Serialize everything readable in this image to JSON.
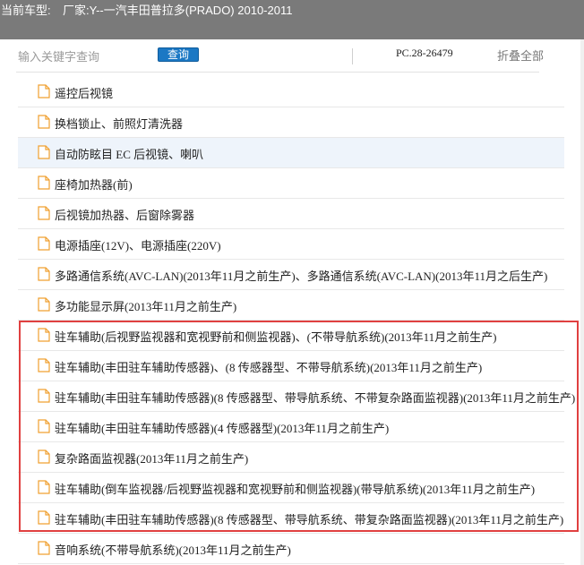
{
  "header": {
    "car_model_label": "当前车型:",
    "car_model_value": "厂家:Y--一汽丰田普拉多(PRADO) 2010-2011"
  },
  "search": {
    "placeholder": "输入关键字查询",
    "button_label": "查询"
  },
  "toolbar": {
    "pc_code": "PC.28-26479",
    "collapse_all_label": "折叠全部"
  },
  "colors": {
    "header_bg": "#7a7a7a",
    "button_bg": "#1b78c4",
    "highlight_row": "#eef4fb",
    "annotation_box": "#e04040",
    "doc_icon": "#f0a030"
  },
  "items": [
    {
      "label": "遥控后视镜"
    },
    {
      "label": "换档锁止、前照灯清洗器"
    },
    {
      "label": "自动防眩目 EC 后视镜、喇叭"
    },
    {
      "label": "座椅加热器(前)"
    },
    {
      "label": "后视镜加热器、后窗除雾器"
    },
    {
      "label": "电源插座(12V)、电源插座(220V)"
    },
    {
      "label": "多路通信系统(AVC-LAN)(2013年11月之前生产)、多路通信系统(AVC-LAN)(2013年11月之后生产)"
    },
    {
      "label": "多功能显示屏(2013年11月之前生产)"
    },
    {
      "label": "驻车辅助(后视野监视器和宽视野前和侧监视器)、(不带导航系统)(2013年11月之前生产)"
    },
    {
      "label": "驻车辅助(丰田驻车辅助传感器)、(8 传感器型、不带导航系统)(2013年11月之前生产)"
    },
    {
      "label": "驻车辅助(丰田驻车辅助传感器)(8 传感器型、带导航系统、不带复杂路面监视器)(2013年11月之前生产)"
    },
    {
      "label": "驻车辅助(丰田驻车辅助传感器)(4 传感器型)(2013年11月之前生产)"
    },
    {
      "label": "复杂路面监视器(2013年11月之前生产)"
    },
    {
      "label": "驻车辅助(倒车监视器/后视野监视器和宽视野前和侧监视器)(带导航系统)(2013年11月之前生产)"
    },
    {
      "label": "驻车辅助(丰田驻车辅助传感器)(8 传感器型、带导航系统、带复杂路面监视器)(2013年11月之前生产)"
    },
    {
      "label": "音响系统(不带导航系统)(2013年11月之前生产)"
    }
  ]
}
